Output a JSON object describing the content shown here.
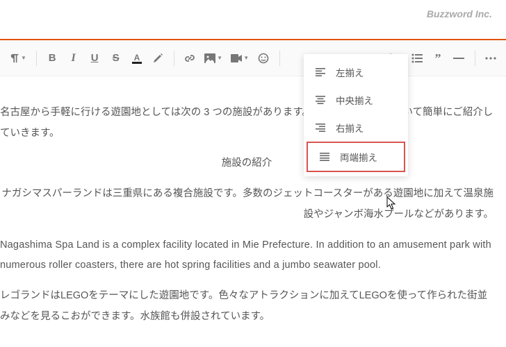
{
  "brand": "Buzzword Inc.",
  "toolbar": {
    "para_style_icon": "paragraph-style",
    "more_icon": "more"
  },
  "dropdown": {
    "items": [
      {
        "label": "左揃え",
        "icon": "align-left"
      },
      {
        "label": "中央揃え",
        "icon": "align-center"
      },
      {
        "label": "右揃え",
        "icon": "align-right"
      },
      {
        "label": "両端揃え",
        "icon": "align-justify"
      }
    ]
  },
  "content": {
    "p1": "名古屋から手軽に行ける遊園地としては次の 3 つの施設があります。それぞれの施設について簡単にご紹介していきます。",
    "heading": "施設の紹介",
    "p2": "ナガシマスパーランドは三重県にある複合施設です。多数のジェットコースターがある遊園地に加えて温泉施設やジャンボ海水プールなどがあります。",
    "p3": "Nagashima Spa Land is a complex facility located in Mie Prefecture. In addition to an amusement park with numerous roller coasters, there are hot spring facilities and a jumbo seawater pool.",
    "p4": "レゴランドはLEGOをテーマにした遊園地です。色々なアトラクションに加えてLEGOを使って作られた街並みなどを見るこおができます。水族館も併設されています。"
  }
}
